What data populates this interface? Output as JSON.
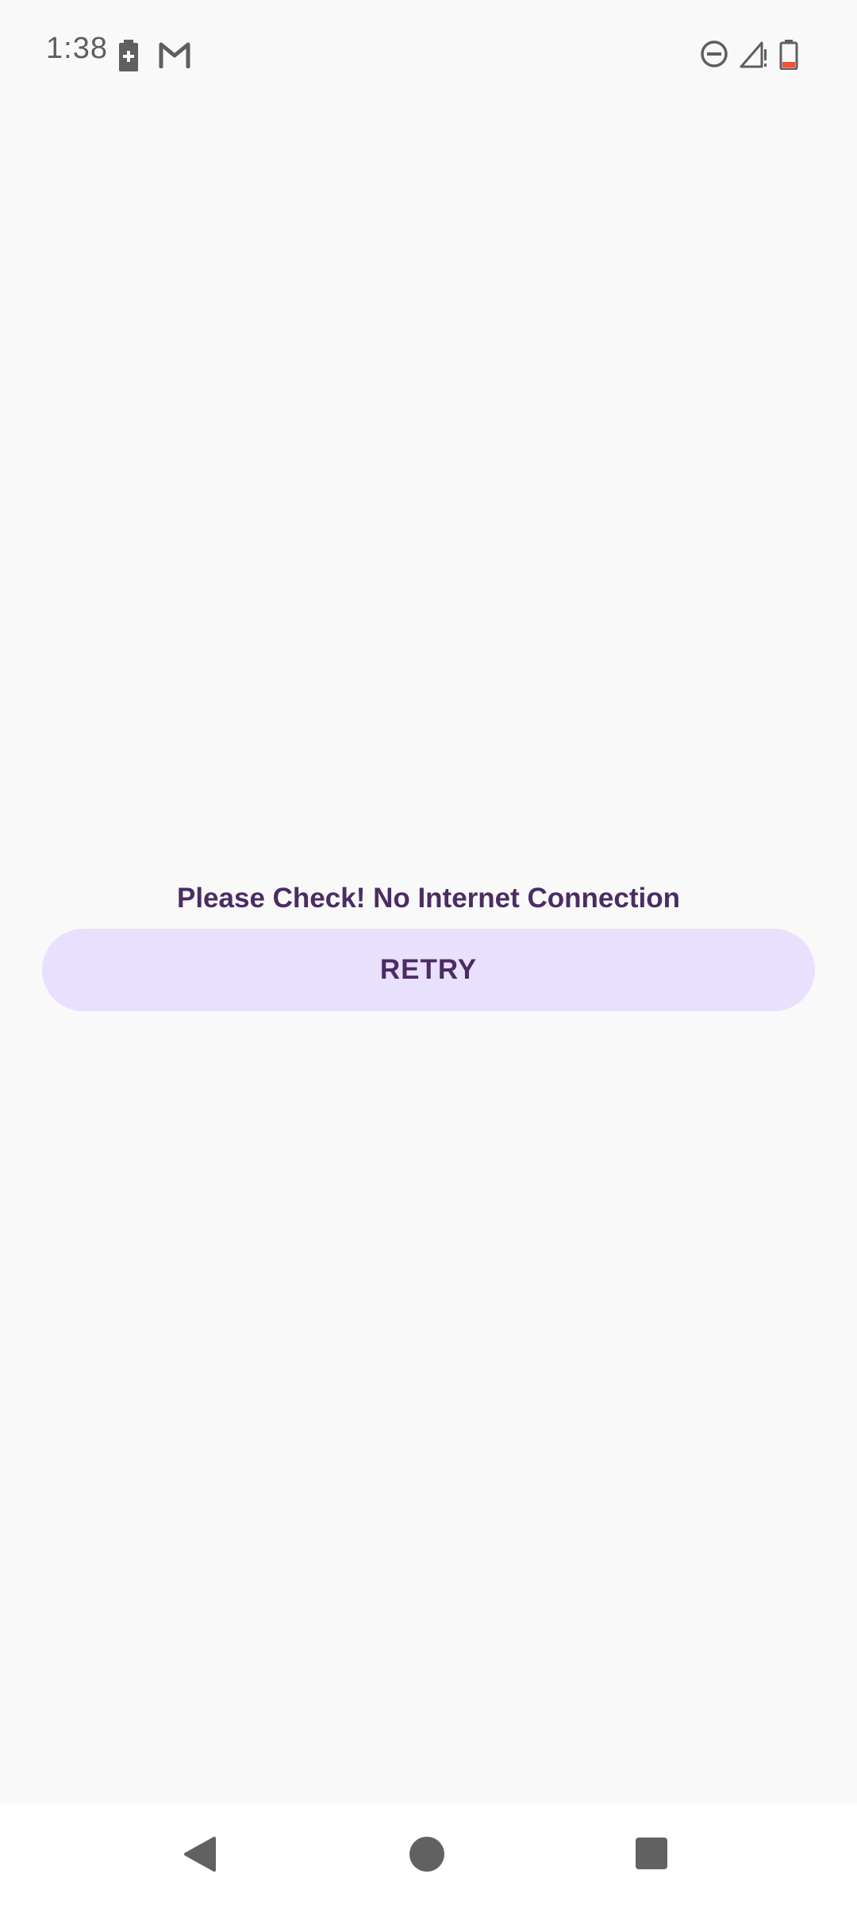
{
  "status_bar": {
    "time": "1:38",
    "icons": [
      "battery-saver-icon",
      "gmail-icon",
      "do-not-disturb-icon",
      "signal-icon",
      "battery-icon"
    ]
  },
  "main": {
    "message": "Please Check! No Internet Connection",
    "retry_label": "RETRY"
  },
  "nav_bar": {
    "buttons": [
      "back-icon",
      "home-icon",
      "recents-icon"
    ]
  },
  "colors": {
    "background": "#f9f9f9",
    "text_primary": "#4b2c63",
    "button_background": "#e8e0fd",
    "status_icons": "#5f5f5f",
    "battery_low": "#e8553c"
  }
}
